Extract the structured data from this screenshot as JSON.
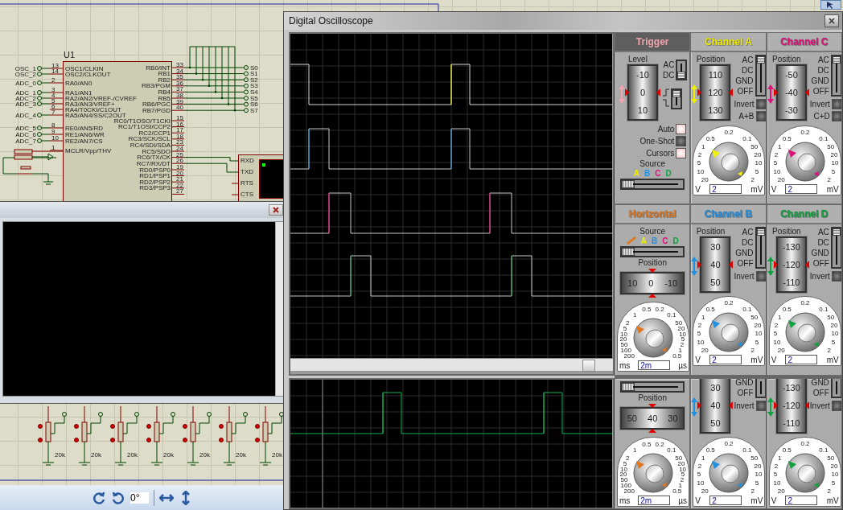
{
  "schematic": {
    "chip": {
      "ref": "U1",
      "left_pins": [
        {
          "number": "13",
          "name": "OSC1/CLKIN",
          "net": "OSC_1"
        },
        {
          "number": "14",
          "name": "OSC2/CLKOUT",
          "net": "OSC_2"
        },
        {
          "number": "2",
          "name": "RA0/AN0",
          "net": "ADC_0"
        },
        {
          "number": "3",
          "name": "RA1/AN1",
          "net": "ADC_1"
        },
        {
          "number": "4",
          "name": "RA2/AN2/VREF-/CVREF",
          "net": "ADC_2"
        },
        {
          "number": "5",
          "name": "RA3/AN3/VREF+",
          "net": "ADC_3"
        },
        {
          "number": "6",
          "name": "RA4/T0CKI/C1OUT"
        },
        {
          "number": "7",
          "name": "RA5/AN4/SS/C2OUT",
          "net": "ADC_4"
        },
        {
          "number": "8",
          "name": "RE0/AN5/RD",
          "net": "ADC_5"
        },
        {
          "number": "9",
          "name": "RE1/AN6/WR",
          "net": "ADC_6"
        },
        {
          "number": "10",
          "name": "RE2/AN7/CS",
          "net": "ADC_7"
        },
        {
          "number": "1",
          "name": "MCLR/Vpp/THV"
        }
      ],
      "right_pins": [
        {
          "number": "33",
          "name": "RB0/INT",
          "net": "S0"
        },
        {
          "number": "34",
          "name": "RB1",
          "net": "S1"
        },
        {
          "number": "35",
          "name": "RB2",
          "net": "S2"
        },
        {
          "number": "36",
          "name": "RB3/PGM",
          "net": "S3"
        },
        {
          "number": "37",
          "name": "RB4",
          "net": "S4"
        },
        {
          "number": "38",
          "name": "RB5",
          "net": "S5"
        },
        {
          "number": "39",
          "name": "RB6/PGC",
          "net": "S6"
        },
        {
          "number": "40",
          "name": "RB7/PGD",
          "net": "S7"
        },
        {
          "number": "15",
          "name": "RC0/T1OSO/T1CKI"
        },
        {
          "number": "16",
          "name": "RC1/T1OSI/CCP2"
        },
        {
          "number": "17",
          "name": "RC2/CCP1"
        },
        {
          "number": "18",
          "name": "RC3/SCK/SCL"
        },
        {
          "number": "23",
          "name": "RC4/SDI/SDA"
        },
        {
          "number": "24",
          "name": "RC5/SDO"
        },
        {
          "number": "25",
          "name": "RC6/TX/CK"
        },
        {
          "number": "26",
          "name": "RC7/RX/DT"
        },
        {
          "number": "19",
          "name": "RD0/PSP0"
        },
        {
          "number": "20",
          "name": "RD1/PSP1"
        },
        {
          "number": "21",
          "name": "RD2/PSP2"
        },
        {
          "number": "22",
          "name": "RD3/PSP3"
        },
        {
          "number": "27"
        }
      ]
    },
    "terminal_pins": [
      "RXD",
      "TXD",
      "RTS",
      "CTS"
    ],
    "resistors": [
      "20k",
      "20k",
      "20k",
      "20k",
      "20k",
      "20k",
      "20k"
    ]
  },
  "toolbar": {
    "angle": "0°"
  },
  "oscilloscope": {
    "title": "Digital Oscilloscope",
    "panels": [
      {
        "kind": "trigger",
        "title": "Trigger",
        "color": "#f0a4ae",
        "level_label": "Level",
        "scale": [
          "-10",
          "0",
          "10"
        ],
        "coupling": [
          {
            "label": "AC",
            "selected": false
          },
          {
            "label": "DC",
            "selected": true
          }
        ],
        "slope": [
          {
            "kind": "rising",
            "selected": true
          },
          {
            "kind": "falling",
            "selected": false
          }
        ],
        "buttons": [
          {
            "label": "Auto",
            "on": true
          },
          {
            "label": "One-Shot",
            "on": false
          },
          {
            "label": "Cursors",
            "on": true
          }
        ],
        "source_label": "Source",
        "sources": [
          {
            "label": "A",
            "color": "#f0f000",
            "selected": true
          },
          {
            "label": "B",
            "color": "#2090e0",
            "selected": false
          },
          {
            "label": "C",
            "color": "#e0107a",
            "selected": false
          },
          {
            "label": "D",
            "color": "#10a040",
            "selected": false
          }
        ]
      },
      {
        "kind": "channel",
        "title": "Channel A",
        "color": "#f0f000",
        "position_label": "Position",
        "scale": [
          "110",
          "120",
          "130"
        ],
        "coupling": [
          {
            "label": "AC",
            "selected": true
          },
          {
            "label": "DC",
            "selected": false
          },
          {
            "label": "GND",
            "selected": false
          },
          {
            "label": "OFF",
            "selected": false
          }
        ],
        "toggles": [
          {
            "label": "Invert",
            "on": false
          },
          {
            "label": "A+B",
            "on": false
          }
        ],
        "knob": {
          "top_labels": [
            "0.5",
            "0.2",
            "0.1"
          ],
          "left_labels": [
            "1",
            "2",
            "5",
            "10",
            "20"
          ],
          "right_labels": [
            "50",
            "20",
            "10",
            "5",
            "2"
          ],
          "unit_left": "V",
          "unit_right": "mV",
          "value": "2"
        }
      },
      {
        "kind": "channel",
        "title": "Channel C",
        "color": "#e0107a",
        "position_label": "Position",
        "scale": [
          "-50",
          "-40",
          "-30"
        ],
        "coupling": [
          {
            "label": "AC",
            "selected": true
          },
          {
            "label": "DC",
            "selected": false
          },
          {
            "label": "GND",
            "selected": false
          },
          {
            "label": "OFF",
            "selected": false
          }
        ],
        "toggles": [
          {
            "label": "Invert",
            "on": false
          },
          {
            "label": "C+D",
            "on": false
          }
        ],
        "knob": {
          "top_labels": [
            "0.5",
            "0.2",
            "0.1"
          ],
          "left_labels": [
            "1",
            "2",
            "5",
            "10",
            "20"
          ],
          "right_labels": [
            "50",
            "20",
            "10",
            "5",
            "2"
          ],
          "unit_left": "V",
          "unit_right": "mV",
          "value": "2"
        }
      },
      {
        "kind": "horizontal",
        "title": "Horizontal",
        "color": "#e07820",
        "source_label": "Source",
        "sources": [
          {
            "kind": "ramp",
            "color": "#e07820",
            "selected": true
          },
          {
            "label": "A",
            "color": "#f0f000",
            "selected": false
          },
          {
            "label": "B",
            "color": "#2090e0",
            "selected": false
          },
          {
            "label": "C",
            "color": "#e0107a",
            "selected": false
          },
          {
            "label": "D",
            "color": "#10a040",
            "selected": false
          }
        ],
        "position_label": "Position",
        "scale": [
          "10",
          "0",
          "-10"
        ],
        "knob": {
          "top_labels": [
            "1",
            "0.5",
            "0.2",
            "0.1"
          ],
          "left_labels": [
            "2",
            "5",
            "10",
            "20",
            "50",
            "100",
            "200"
          ],
          "right_labels": [
            "50",
            "20",
            "10",
            "5",
            "2",
            "1",
            "0.5"
          ],
          "unit_left": "ms",
          "unit_right": "µs",
          "value": "2m"
        }
      },
      {
        "kind": "channel",
        "title": "Channel B",
        "color": "#2090e0",
        "position_label": "Position",
        "scale": [
          "30",
          "40",
          "50"
        ],
        "coupling": [
          {
            "label": "AC",
            "selected": true
          },
          {
            "label": "DC",
            "selected": false
          },
          {
            "label": "GND",
            "selected": false
          },
          {
            "label": "OFF",
            "selected": false
          }
        ],
        "toggles": [
          {
            "label": "Invert",
            "on": false
          }
        ],
        "knob": {
          "top_labels": [
            "0.5",
            "0.2",
            "0.1"
          ],
          "left_labels": [
            "1",
            "2",
            "5",
            "10",
            "20"
          ],
          "right_labels": [
            "50",
            "20",
            "10",
            "5",
            "2"
          ],
          "unit_left": "V",
          "unit_right": "mV",
          "value": "2"
        }
      },
      {
        "kind": "channel",
        "title": "Channel D",
        "color": "#10a040",
        "position_label": "Position",
        "scale": [
          "-130",
          "-120",
          "-110"
        ],
        "coupling": [
          {
            "label": "AC",
            "selected": true
          },
          {
            "label": "DC",
            "selected": false
          },
          {
            "label": "GND",
            "selected": false
          },
          {
            "label": "OFF",
            "selected": false
          }
        ],
        "toggles": [
          {
            "label": "Invert",
            "on": false
          }
        ],
        "knob": {
          "top_labels": [
            "0.5",
            "0.2",
            "0.1"
          ],
          "left_labels": [
            "1",
            "2",
            "5",
            "10",
            "20"
          ],
          "right_labels": [
            "50",
            "20",
            "10",
            "5",
            "2"
          ],
          "unit_left": "V",
          "unit_right": "mV",
          "value": "2"
        }
      }
    ],
    "lower_panels": [
      {
        "kind": "horizontal",
        "color": "#e07820",
        "sources": [
          {
            "selected": true
          },
          {
            "selected": false
          },
          {
            "selected": false
          },
          {
            "selected": false
          },
          {
            "selected": false
          }
        ],
        "position_label": "Position",
        "scale": [
          "50",
          "40",
          "30"
        ],
        "knob": {
          "top_labels": [
            "1",
            "0.5",
            "0.2",
            "0.1"
          ],
          "left_labels": [
            "2",
            "5",
            "10",
            "20",
            "50",
            "100",
            "200"
          ],
          "right_labels": [
            "50",
            "20",
            "10",
            "5",
            "2",
            "1",
            "0.5"
          ],
          "unit_left": "ms",
          "unit_right": "µs",
          "value": "2m"
        }
      },
      {
        "kind": "channel",
        "color": "#2090e0",
        "scale": [
          "30",
          "40",
          "50"
        ],
        "coupling": [
          {
            "label": "GND",
            "selected": false
          },
          {
            "label": "OFF",
            "selected": false
          }
        ],
        "toggles": [
          {
            "label": "Invert",
            "on": false
          }
        ],
        "knob": {
          "top_labels": [
            "0.5",
            "0.2",
            "0.1"
          ],
          "left_labels": [
            "1",
            "2",
            "5",
            "10",
            "20"
          ],
          "right_labels": [
            "50",
            "20",
            "10",
            "5",
            "2"
          ],
          "unit_left": "V",
          "unit_right": "mV",
          "value": "2"
        }
      },
      {
        "kind": "channel",
        "color": "#10a040",
        "scale": [
          "-130",
          "-120",
          "-110"
        ],
        "coupling": [
          {
            "label": "GND",
            "selected": false
          },
          {
            "label": "OFF",
            "selected": false
          }
        ],
        "toggles": [
          {
            "label": "Invert",
            "on": false
          }
        ],
        "knob": {
          "top_labels": [
            "0.5",
            "0.2",
            "0.1"
          ],
          "left_labels": [
            "1",
            "2",
            "5",
            "10",
            "20"
          ],
          "right_labels": [
            "50",
            "20",
            "10",
            "5",
            "2"
          ],
          "unit_left": "V",
          "unit_right": "mV",
          "value": "2"
        }
      }
    ]
  }
}
